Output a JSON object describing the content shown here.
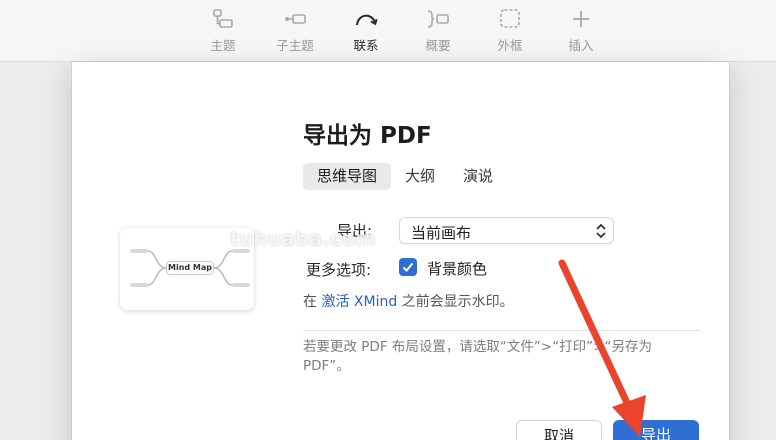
{
  "toolbar": {
    "items": [
      {
        "label": "主题",
        "icon": "topic-icon"
      },
      {
        "label": "子主题",
        "icon": "subtopic-icon"
      },
      {
        "label": "联系",
        "icon": "relationship-icon",
        "active": true
      },
      {
        "label": "概要",
        "icon": "summary-icon"
      },
      {
        "label": "外框",
        "icon": "boundary-icon"
      },
      {
        "label": "插入",
        "icon": "plus-icon"
      }
    ]
  },
  "dialog": {
    "title": "导出为 PDF",
    "tabs": [
      {
        "label": "思维导图",
        "selected": true
      },
      {
        "label": "大纲",
        "selected": false
      },
      {
        "label": "演说",
        "selected": false
      }
    ],
    "export_label": "导出:",
    "export_value": "当前画布",
    "more_options_label": "更多选项:",
    "background_checkbox": {
      "label": "背景颜色",
      "checked": true
    },
    "watermark_note": {
      "prefix": "在 ",
      "link": "激活 XMind",
      "suffix": " 之前会显示水印。"
    },
    "hint": "若要更改 PDF 布局设置，请选取“文件”>“打印”>“另存为 PDF”。",
    "preview": {
      "center_label": "Mind Map"
    },
    "buttons": {
      "cancel": "取消",
      "export": "导出"
    }
  },
  "overlay": {
    "site_watermark": "tuhuaba.com",
    "arrow_color": "#e8452c"
  },
  "colors": {
    "accent": "#2f6fd3",
    "link": "#2463c9"
  }
}
